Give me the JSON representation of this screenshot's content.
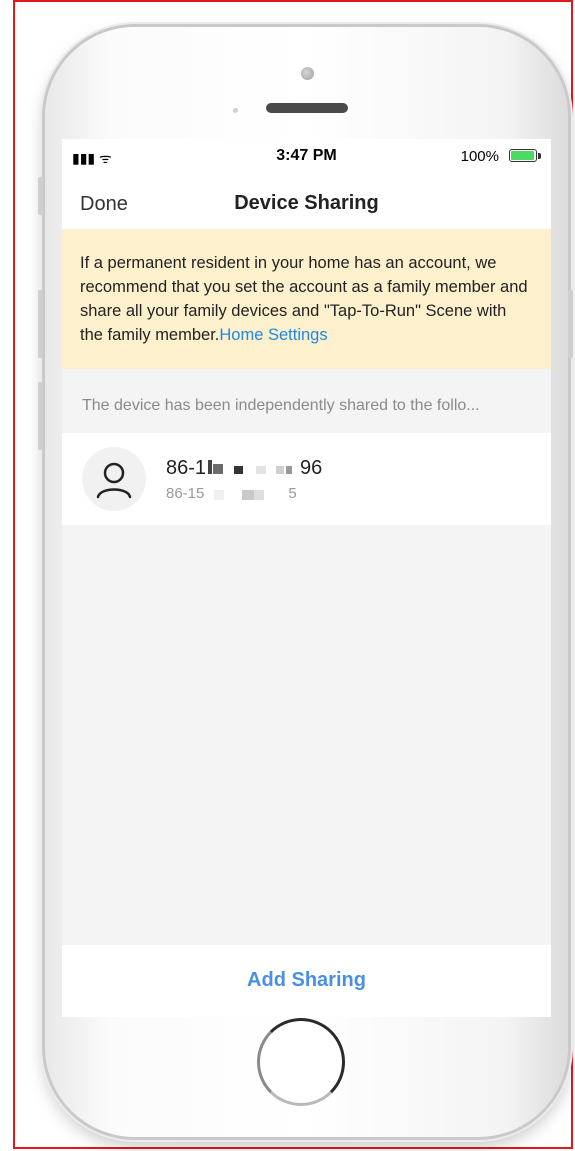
{
  "status_bar": {
    "signal": "▮▮▮ ᯤ",
    "time": "3:47 PM",
    "battery_percent": "100%",
    "battery_level": 1.0,
    "battery_color": "#4cd964"
  },
  "nav": {
    "left_label": "Done",
    "title": "Device Sharing"
  },
  "notice": {
    "text": "If a permanent resident in your home has an account, we recommend that you set the account as a family member and share all your family devices and \"Tap-To-Run\" Scene with the family member.",
    "link_label": "Home Settings",
    "link_color": "#1e88e5",
    "background": "#fdf0cc"
  },
  "shared_list": {
    "header": "The device has been independently shared to the follo...",
    "users": [
      {
        "name": "86-1",
        "name_suffix": "96",
        "subtitle": "86-15",
        "subtitle_suffix": "5",
        "avatar_icon": "user-icon"
      }
    ]
  },
  "actions": {
    "add_sharing_label": "Add Sharing",
    "accent": "#4a90e2"
  }
}
